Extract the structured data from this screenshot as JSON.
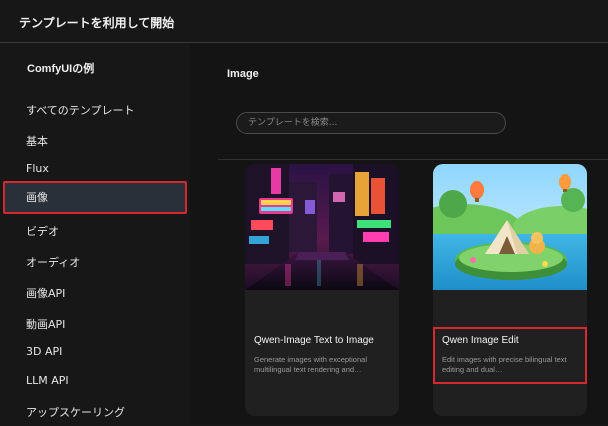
{
  "header": {
    "title": "テンプレートを利用して開始"
  },
  "sidebar": {
    "heading": "ComfyUIの例",
    "items": [
      {
        "label": "すべてのテンプレート",
        "active": false
      },
      {
        "label": "基本",
        "active": false
      },
      {
        "label": "Flux",
        "active": false
      },
      {
        "label": "画像",
        "active": true
      },
      {
        "label": "ビデオ",
        "active": false
      },
      {
        "label": "オーディオ",
        "active": false
      },
      {
        "label": "画像API",
        "active": false
      },
      {
        "label": "動画API",
        "active": false
      },
      {
        "label": "3D API",
        "active": false
      },
      {
        "label": "LLM API",
        "active": false
      },
      {
        "label": "アップスケーリング",
        "active": false
      }
    ]
  },
  "main": {
    "heading": "Image",
    "search": {
      "placeholder": "テンプレートを検索...",
      "value": ""
    },
    "cards": [
      {
        "title": "Qwen-Image Text to Image",
        "description": "Generate images with exceptional multilingual text rendering and…",
        "thumbnail_icon": "neon-street-image"
      },
      {
        "title": "Qwen Image Edit",
        "description": "Edit images with precise bilingual text editing and dual…",
        "thumbnail_icon": "camping-island-image",
        "highlighted": true
      }
    ]
  },
  "colors": {
    "background": "#171717",
    "highlight_border": "#d8272e",
    "active_item_bg": "#2a3039"
  }
}
